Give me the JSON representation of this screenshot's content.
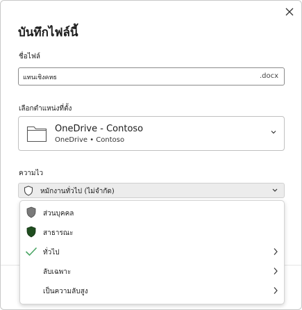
{
  "dialog": {
    "title": "บันทึกไฟล์นี้"
  },
  "filename": {
    "label": "ชื่อไฟล์",
    "value": "แทนเชิงคหธ",
    "extension": ".docx"
  },
  "location": {
    "label": "เลือกตำแหน่งที่ตั้ง",
    "name": "OneDrive - Contoso",
    "sub": "OneDrive • Contoso"
  },
  "sensitivity": {
    "label": "ความไว",
    "value": "หมักงานทั่วไป (ไม่จำกัด)",
    "options": [
      {
        "label": "ส่วนบุคคล",
        "icon": "shield-gray-icon",
        "has_submenu": false
      },
      {
        "label": "สาธารณะ",
        "icon": "shield-green-icon",
        "has_submenu": false
      },
      {
        "label": "ทั่วไป",
        "icon": "checkmark-icon",
        "has_submenu": true
      },
      {
        "label": "ลับเฉพาะ",
        "icon": "",
        "has_submenu": true
      },
      {
        "label": "เป็นความลับสูง",
        "icon": "",
        "has_submenu": true
      }
    ]
  },
  "colors": {
    "check": "#4aa564",
    "shield_gray": "#7a7a7a",
    "shield_green": "#1f4d1f"
  }
}
